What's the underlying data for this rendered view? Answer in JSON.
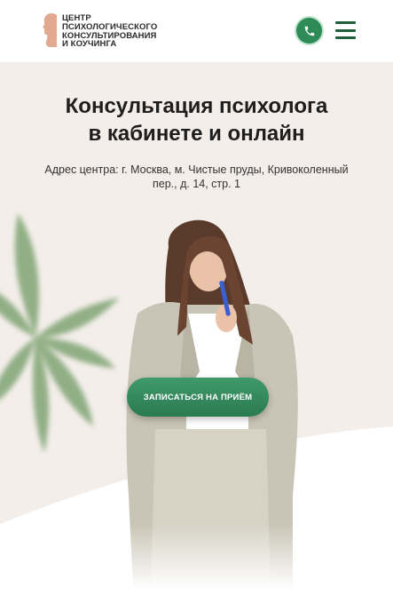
{
  "header": {
    "logo_lines": [
      "ЦЕНТР",
      "ПСИХОЛОГИЧЕСКОГО",
      "КОНСУЛЬТИРОВАНИЯ",
      "И КОУЧИНГА"
    ],
    "phone_icon": "phone-icon",
    "menu_icon": "hamburger-menu-icon"
  },
  "hero": {
    "title_line1": "Консультация психолога",
    "title_line2": "в кабинете и онлайн",
    "address": "Адрес центра: г. Москва, м. Чистые пруды, Кривоколенный пер., д. 14, стр. 1",
    "cta_label": "ЗАПИСАТЬСЯ НА ПРИЁМ"
  },
  "colors": {
    "accent": "#2e8b57",
    "hero_bg": "#f4eeea",
    "text": "#1e1e1e"
  }
}
